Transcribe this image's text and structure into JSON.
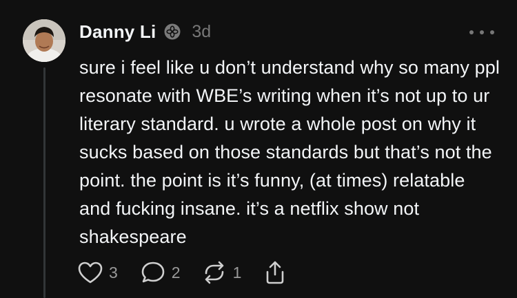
{
  "post": {
    "author": "Danny Li",
    "time": "3d",
    "text": "sure i feel like u don’t understand why so many ppl resonate with WBE’s writing when it’s not up to ur literary standard. u wrote a whole post on why it sucks based on those standards but that’s not the point. the point is it’s funny, (at times) relatable and fucking insane. it’s a netflix show not shakespeare",
    "likes": "3",
    "replies": "2",
    "reposts": "1"
  },
  "icons": {
    "avatar": "avatar",
    "badge": "flower-badge-icon",
    "more": "more-options-icon",
    "like": "heart-icon",
    "reply": "comment-icon",
    "repost": "repost-icon",
    "share": "share-icon"
  },
  "colors": {
    "background": "#101010",
    "text": "#f3f5f7",
    "muted": "#777777"
  }
}
